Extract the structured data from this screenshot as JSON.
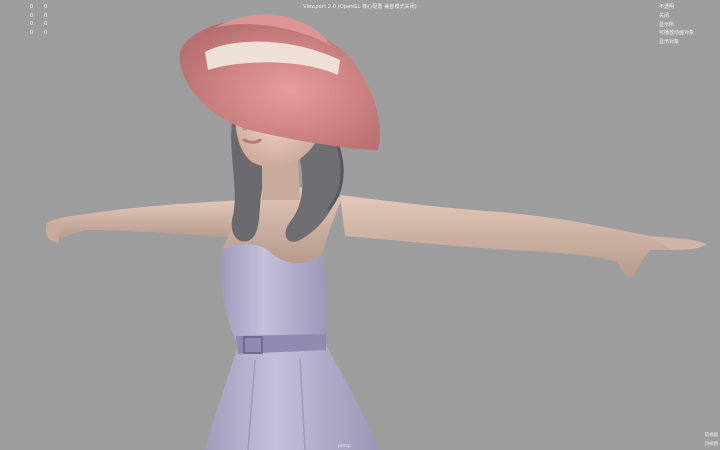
{
  "viewport": {
    "title": "Viewport 2.0 (OpenGL 核心配置 兼容模式关闭)",
    "stats": [
      {
        "label": "",
        "value": "0"
      },
      {
        "label": "",
        "value": "0"
      },
      {
        "label": "",
        "value": "0"
      },
      {
        "label": "",
        "value": "0"
      }
    ],
    "right_menu": [
      "不透明",
      "关闭",
      "显示所",
      "可播放动画对象",
      "显示对象"
    ],
    "bottom_center": "persp",
    "bottom_right": [
      "前视图",
      "顶视图"
    ]
  },
  "colors": {
    "background": "#9d9d9d",
    "skin": "#d9bcae",
    "hat": "#d98c8c",
    "hat_band": "#efe0d6",
    "hair": "#6e6e72",
    "dress": "#b6b3cf",
    "belt": "#8f8ab0"
  }
}
